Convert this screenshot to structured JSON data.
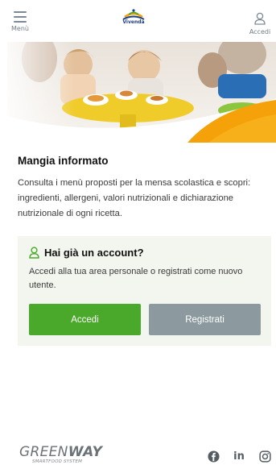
{
  "header": {
    "menu_label": "Menù",
    "logo_text": "Vivenda",
    "login_label": "Accedi"
  },
  "hero": {
    "icon": "school-canteen-photo"
  },
  "intro": {
    "title": "Mangia informato",
    "text": "Consulta i menù proposti per la mensa scolastica e scopri: ingredienti, allergeni, valori nutrizionali e dichiarazione nutrizionale di ogni ricetta."
  },
  "account_card": {
    "title": "Hai già un account?",
    "text": "Accedi alla tua area personale o registrati come nuovo utente.",
    "login_button": "Accedi",
    "register_button": "Registrati"
  },
  "footer": {
    "brand_light": "GREEN",
    "brand_bold": "WAY",
    "brand_sub": "SMARTFOOD SYSTEM",
    "social_linkedin": "in"
  },
  "colors": {
    "accent_green": "#4aa82b",
    "secondary_gray": "#8c9aa0",
    "card_bg": "#f3f6ee",
    "hero_orange": "#f5a20a",
    "brand_blue": "#1e3f8a"
  }
}
